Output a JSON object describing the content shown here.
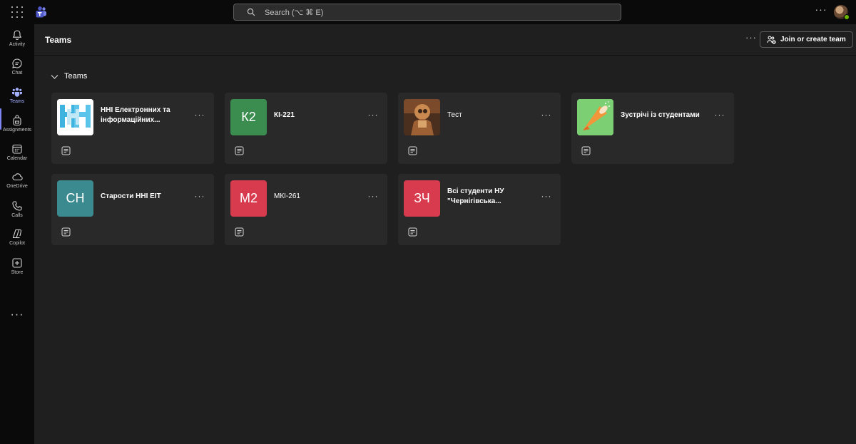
{
  "topbar": {
    "search_placeholder": "Search (⌥ ⌘ E)",
    "more_label": "···"
  },
  "rail": {
    "items": [
      {
        "label": "Activity",
        "icon": "bell-icon"
      },
      {
        "label": "Chat",
        "icon": "chat-icon"
      },
      {
        "label": "Teams",
        "icon": "teams-icon",
        "active": true
      },
      {
        "label": "Assignments",
        "icon": "backpack-icon"
      },
      {
        "label": "Calendar",
        "icon": "calendar-icon"
      },
      {
        "label": "OneDrive",
        "icon": "cloud-icon"
      },
      {
        "label": "Calls",
        "icon": "phone-icon"
      },
      {
        "label": "Copilot",
        "icon": "copilot-icon"
      },
      {
        "label": "Store",
        "icon": "plus-square-icon"
      }
    ],
    "more_label": "···"
  },
  "header": {
    "title": "Teams",
    "more_label": "···",
    "join_button": "Join or create team"
  },
  "section": {
    "label": "Teams"
  },
  "teams": [
    {
      "name": "ННІ Електронних та інформаційних...",
      "bold": true,
      "avatar": "logo"
    },
    {
      "name": "КІ-221",
      "bold": true,
      "initials": "К2",
      "color": "#3b8d4f"
    },
    {
      "name": "Тест",
      "bold": false,
      "avatar": "photo"
    },
    {
      "name": "Зустрічі із студентами",
      "bold": true,
      "avatar": "megaphone",
      "color": "#7ccf73"
    },
    {
      "name": "Старости ННІ ЕІТ",
      "bold": true,
      "initials": "СН",
      "color": "#3a8a8f"
    },
    {
      "name": "МКІ-261",
      "bold": false,
      "initials": "М2",
      "color": "#d83b4e"
    },
    {
      "name": "Всі студенти НУ \"Чернігівська...",
      "bold": true,
      "initials": "ЗЧ",
      "color": "#d83b4e"
    }
  ],
  "colors": {
    "accent": "#7f85f5",
    "background": "#1f1f1f",
    "card": "#292929",
    "rail": "#0a0a0a"
  }
}
